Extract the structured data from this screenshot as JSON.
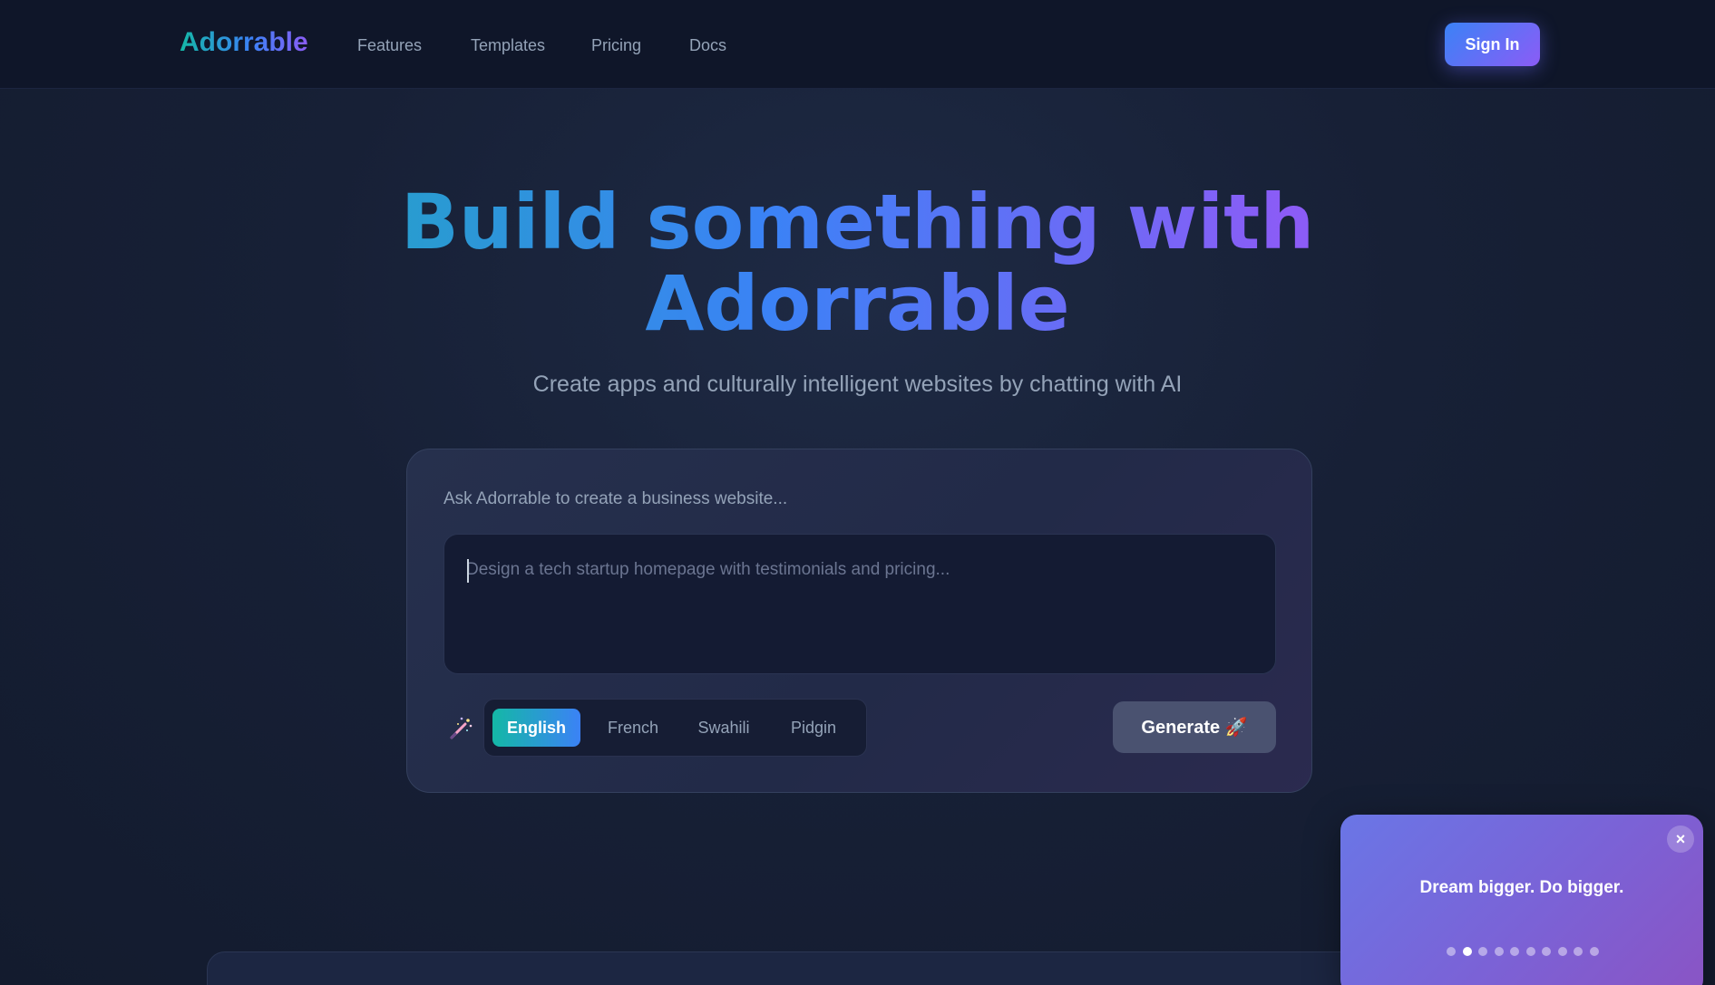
{
  "nav": {
    "logo": "Adorrable",
    "links": [
      "Features",
      "Templates",
      "Pricing",
      "Docs"
    ],
    "sign_in": "Sign In"
  },
  "hero": {
    "title_line1": "Build something with",
    "title_line2": "Adorrable",
    "subtitle": "Create apps and culturally intelligent websites by chatting with AI"
  },
  "card": {
    "label": "Ask Adorrable to create a business website...",
    "prompt_placeholder": "Design a tech startup homepage with testimonials and pricing...",
    "prompt_value": "",
    "languages": [
      "English",
      "French",
      "Swahili",
      "Pidgin"
    ],
    "selected_language": "English",
    "generate_label": "Generate 🚀"
  },
  "toast": {
    "message": "Dream bigger. Do bigger.",
    "close": "×",
    "slide_count": 10,
    "active_slide": 2
  },
  "colors": {
    "background": "#131b2e",
    "brand_gradient": [
      "#14b8a6",
      "#3b82f6",
      "#8b5cf6"
    ],
    "toast_gradient": [
      "#6a76e6",
      "#8a54c4"
    ]
  },
  "icons": {
    "wand": "magic-wand-icon",
    "rocket": "rocket-icon",
    "close": "close-icon"
  }
}
